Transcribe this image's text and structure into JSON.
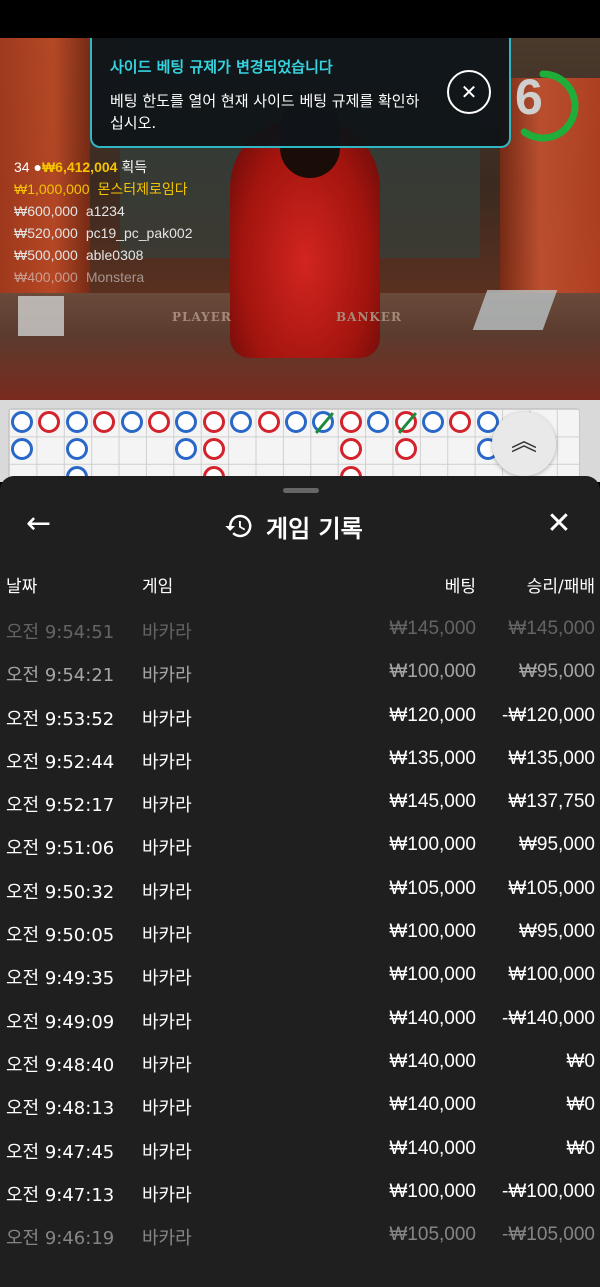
{
  "notice": {
    "title": "사이드 베팅 규제가 변경되었습니다",
    "body": "베팅 한도를 열어 현재 사이드 베팅 규제를 확인하십시오."
  },
  "timer": {
    "value": "6",
    "progress": 0.6,
    "color": "#1fae3a"
  },
  "winners": {
    "count": "34",
    "total": "₩6,412,004",
    "total_label": "획득",
    "list": [
      {
        "amount": "₩1,000,000",
        "name": "몬스터제로임다"
      },
      {
        "amount": "₩600,000",
        "name": "a1234"
      },
      {
        "amount": "₩520,000",
        "name": "pc19_pc_pak002"
      },
      {
        "amount": "₩500,000",
        "name": "able0308"
      },
      {
        "amount": "₩400,000",
        "name": "Monstera"
      }
    ]
  },
  "table_labels": {
    "player": "PLAYER",
    "banker": "BANKER"
  },
  "roadmap": {
    "colors": {
      "player": "#2a68c8",
      "banker": "#d3232c",
      "tie": "#1c8c3c"
    },
    "columns": [
      [
        "P",
        "P"
      ],
      [
        "B"
      ],
      [
        "P",
        "P",
        "P"
      ],
      [
        "B"
      ],
      [
        "P"
      ],
      [
        "B"
      ],
      [
        "P",
        "P"
      ],
      [
        "B",
        "B",
        "B"
      ],
      [
        "P"
      ],
      [
        "B"
      ],
      [
        "P"
      ],
      [
        "tie"
      ],
      [
        "B",
        "B",
        "B"
      ],
      [
        "P"
      ],
      [
        "tie-B",
        "B"
      ],
      [
        "P"
      ],
      [
        "B"
      ],
      [
        "P",
        "P"
      ]
    ]
  },
  "sheet": {
    "title": "게임 기록",
    "back_icon": "arrow-left-icon",
    "close_icon": "close-icon",
    "columns": {
      "date": "날짜",
      "game": "게임",
      "bet": "베팅",
      "result": "승리/패배"
    },
    "rows": [
      {
        "time": "오전 9:54:51",
        "game": "바카라",
        "bet": "₩145,000",
        "result": "₩145,000"
      },
      {
        "time": "오전 9:54:21",
        "game": "바카라",
        "bet": "₩100,000",
        "result": "₩95,000"
      },
      {
        "time": "오전 9:53:52",
        "game": "바카라",
        "bet": "₩120,000",
        "result": "-₩120,000"
      },
      {
        "time": "오전 9:52:44",
        "game": "바카라",
        "bet": "₩135,000",
        "result": "₩135,000"
      },
      {
        "time": "오전 9:52:17",
        "game": "바카라",
        "bet": "₩145,000",
        "result": "₩137,750"
      },
      {
        "time": "오전 9:51:06",
        "game": "바카라",
        "bet": "₩100,000",
        "result": "₩95,000"
      },
      {
        "time": "오전 9:50:32",
        "game": "바카라",
        "bet": "₩105,000",
        "result": "₩105,000"
      },
      {
        "time": "오전 9:50:05",
        "game": "바카라",
        "bet": "₩100,000",
        "result": "₩95,000"
      },
      {
        "time": "오전 9:49:35",
        "game": "바카라",
        "bet": "₩100,000",
        "result": "₩100,000"
      },
      {
        "time": "오전 9:49:09",
        "game": "바카라",
        "bet": "₩140,000",
        "result": "-₩140,000"
      },
      {
        "time": "오전 9:48:40",
        "game": "바카라",
        "bet": "₩140,000",
        "result": "₩0"
      },
      {
        "time": "오전 9:48:13",
        "game": "바카라",
        "bet": "₩140,000",
        "result": "₩0"
      },
      {
        "time": "오전 9:47:45",
        "game": "바카라",
        "bet": "₩140,000",
        "result": "₩0"
      },
      {
        "time": "오전 9:47:13",
        "game": "바카라",
        "bet": "₩100,000",
        "result": "-₩100,000"
      },
      {
        "time": "오전 9:46:19",
        "game": "바카라",
        "bet": "₩105,000",
        "result": "-₩105,000"
      }
    ]
  }
}
